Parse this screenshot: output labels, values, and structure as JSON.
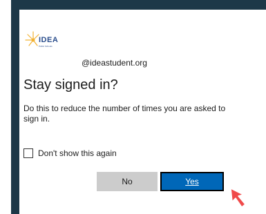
{
  "logo": {
    "brand": "IDEA",
    "tagline": "Public Schools"
  },
  "account": {
    "email": "@ideastudent.org"
  },
  "prompt": {
    "title": "Stay signed in?",
    "description": "Do this to reduce the number of times you are asked to sign in."
  },
  "checkbox": {
    "label": "Don't show this again",
    "checked": false
  },
  "buttons": {
    "no_label": "No",
    "yes_label": "Yes"
  },
  "colors": {
    "frame": "#1d3848",
    "primary": "#0067b8",
    "secondary": "#cccccc",
    "cursor": "#f04a4a"
  }
}
